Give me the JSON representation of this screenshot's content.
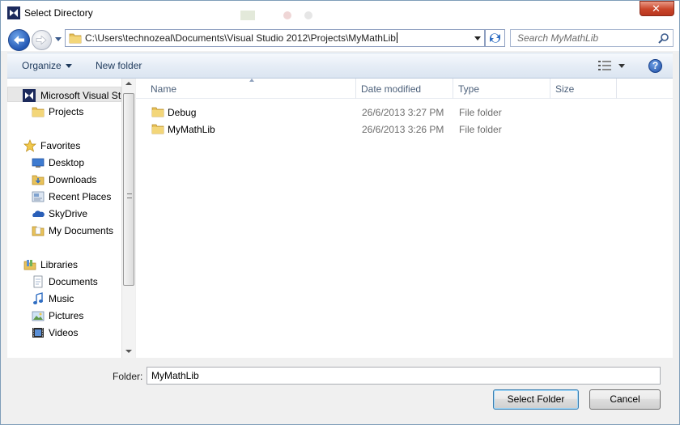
{
  "window": {
    "title": "Select Directory",
    "close_glyph": "✕"
  },
  "address": {
    "path": "C:\\Users\\technozeal\\Documents\\Visual Studio 2012\\Projects\\MyMathLib",
    "search_placeholder": "Search MyMathLib"
  },
  "toolbar": {
    "organize": "Organize",
    "new_folder": "New folder",
    "help_glyph": "?"
  },
  "sidebar": {
    "items": [
      {
        "label": "Microsoft Visual St",
        "icon": "visual-studio-icon"
      },
      {
        "label": "Projects",
        "icon": "folder-icon"
      },
      {
        "label": "Favorites",
        "icon": "star-icon"
      },
      {
        "label": "Desktop",
        "icon": "desktop-icon"
      },
      {
        "label": "Downloads",
        "icon": "downloads-icon"
      },
      {
        "label": "Recent Places",
        "icon": "recent-places-icon"
      },
      {
        "label": "SkyDrive",
        "icon": "skydrive-icon"
      },
      {
        "label": "My Documents",
        "icon": "documents-folder-icon"
      },
      {
        "label": "Libraries",
        "icon": "libraries-icon"
      },
      {
        "label": "Documents",
        "icon": "documents-icon"
      },
      {
        "label": "Music",
        "icon": "music-icon"
      },
      {
        "label": "Pictures",
        "icon": "pictures-icon"
      },
      {
        "label": "Videos",
        "icon": "videos-icon"
      }
    ]
  },
  "columns": {
    "name": "Name",
    "date": "Date modified",
    "type": "Type",
    "size": "Size"
  },
  "files": [
    {
      "name": "Debug",
      "date": "26/6/2013 3:27 PM",
      "type": "File folder"
    },
    {
      "name": "MyMathLib",
      "date": "26/6/2013 3:26 PM",
      "type": "File folder"
    }
  ],
  "bottom": {
    "folder_label": "Folder:",
    "folder_value": "MyMathLib",
    "select_button": "Select Folder",
    "cancel_button": "Cancel"
  },
  "colors": {
    "accent": "#1f4ea4",
    "toolbar_text": "#1e395b",
    "close_red": "#c9452a",
    "folder_yellow": "#e8c25a"
  }
}
